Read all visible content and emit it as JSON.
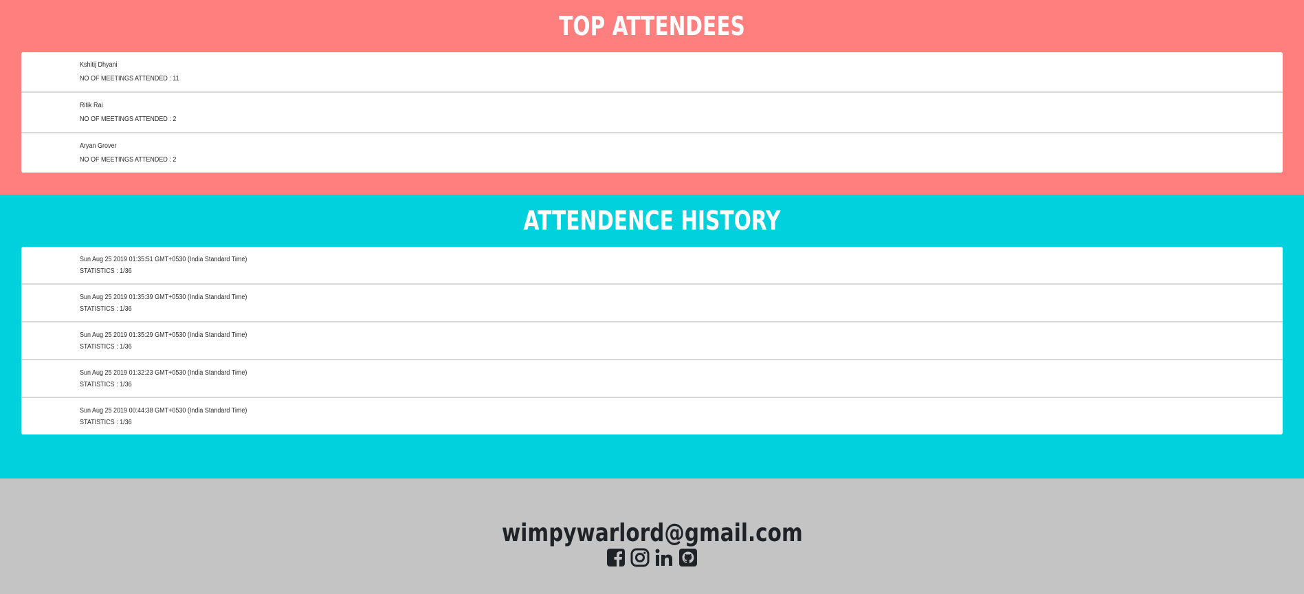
{
  "top_attendees": {
    "title": "TOP ATTENDEES",
    "items": [
      {
        "name": "Kshitij Dhyani",
        "meetings": "NO OF MEETINGS ATTENDED : 11"
      },
      {
        "name": "Ritik Rai",
        "meetings": "NO OF MEETINGS ATTENDED : 2"
      },
      {
        "name": "Aryan Grover",
        "meetings": "NO OF MEETINGS ATTENDED : 2"
      }
    ]
  },
  "attendance_history": {
    "title": "ATTENDENCE HISTORY",
    "items": [
      {
        "date": "Sun Aug 25 2019 01:35:51 GMT+0530 (India Standard Time)",
        "stats": "STATISTICS : 1/36"
      },
      {
        "date": "Sun Aug 25 2019 01:35:39 GMT+0530 (India Standard Time)",
        "stats": "STATISTICS : 1/36"
      },
      {
        "date": "Sun Aug 25 2019 01:35:29 GMT+0530 (India Standard Time)",
        "stats": "STATISTICS : 1/36"
      },
      {
        "date": "Sun Aug 25 2019 01:32:23 GMT+0530 (India Standard Time)",
        "stats": "STATISTICS : 1/36"
      },
      {
        "date": "Sun Aug 25 2019 00:44:38 GMT+0530 (India Standard Time)",
        "stats": "STATISTICS : 1/36"
      }
    ]
  },
  "footer": {
    "email": "wimpywarlord@gmail.com",
    "social_icons": [
      "facebook-icon",
      "instagram-icon",
      "linkedin-icon",
      "github-icon"
    ]
  },
  "colors": {
    "top_bg": "#ff7f7f",
    "history_bg": "#00d1dd",
    "footer_bg": "#c4c4c4",
    "footer_text": "#1f2227"
  }
}
